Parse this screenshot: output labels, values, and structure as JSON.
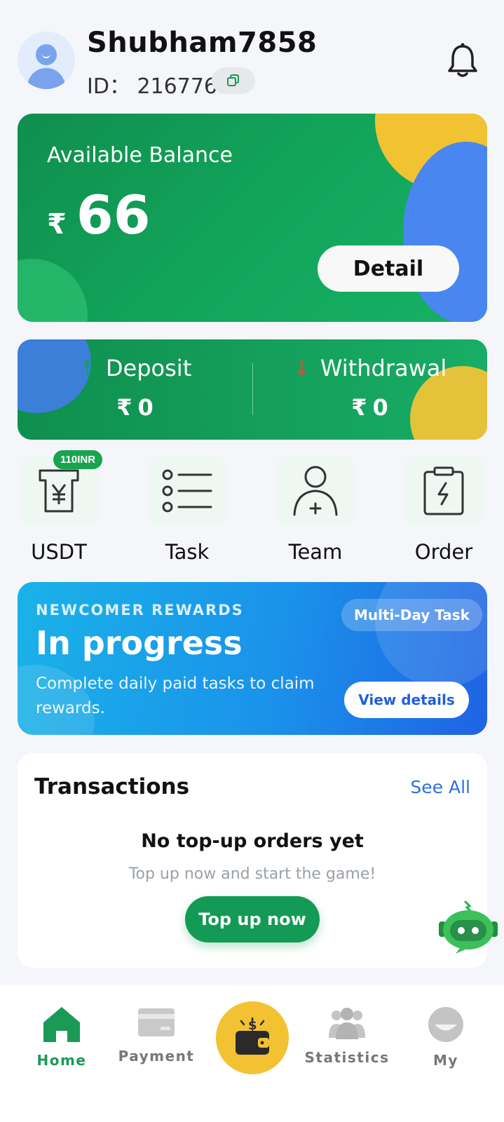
{
  "header": {
    "username": "Shubham7858",
    "id_text": "ID： 216776",
    "icons": {
      "avatar": "user-avatar",
      "copy": "copy-icon",
      "bell": "bell-icon"
    }
  },
  "balance": {
    "label": "Available Balance",
    "currency": "₹",
    "amount": "66",
    "detail_label": "Detail"
  },
  "flows": {
    "deposit": {
      "label": "Deposit",
      "currency": "₹",
      "amount": "0"
    },
    "withdrawal": {
      "label": "Withdrawal",
      "currency": "₹",
      "amount": "0"
    }
  },
  "quick_actions": [
    {
      "label": "USDT",
      "badge": "110INR",
      "icon": "usdt-receipt-icon"
    },
    {
      "label": "Task",
      "icon": "task-list-icon"
    },
    {
      "label": "Team",
      "icon": "team-add-icon"
    },
    {
      "label": "Order",
      "icon": "order-clipboard-icon"
    }
  ],
  "newcomer": {
    "kicker": "NEWCOMER REWARDS",
    "title": "In progress",
    "subtitle": "Complete daily paid tasks to claim rewards.",
    "chip": "Multi-Day Task",
    "button": "View details"
  },
  "transactions": {
    "title": "Transactions",
    "see_all": "See All",
    "empty_title": "No top-up orders yet",
    "empty_hint": "Top up now and start the game!",
    "button": "Top up now"
  },
  "nav": {
    "items": [
      {
        "label": "Home",
        "icon": "home-icon",
        "active": true
      },
      {
        "label": "Payment",
        "icon": "card-icon"
      },
      {
        "label": "Statistics",
        "icon": "users-icon"
      },
      {
        "label": "My",
        "icon": "profile-icon"
      }
    ],
    "center_icon": "wallet-icon"
  },
  "colors": {
    "primary_green": "#139a54",
    "accent_yellow": "#f2c233",
    "accent_blue": "#2f6fe0",
    "background": "#f4f6fa"
  }
}
